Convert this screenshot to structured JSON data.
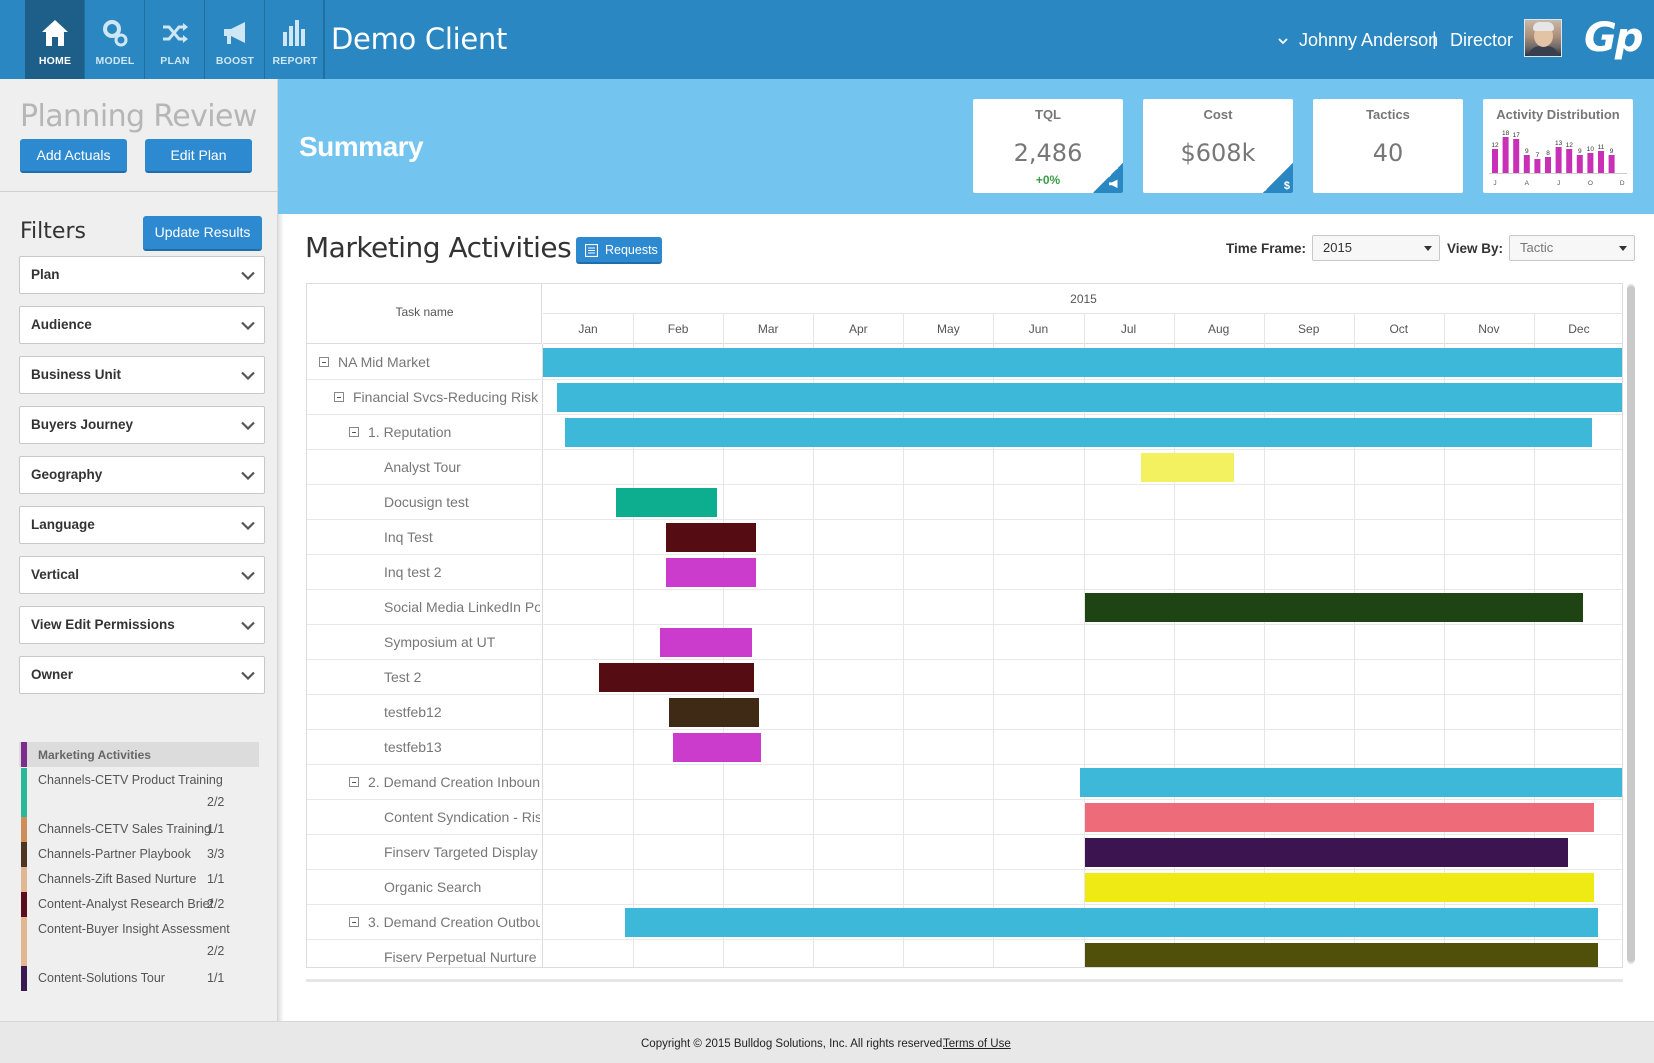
{
  "nav": [
    {
      "label": "HOME",
      "icon": "home-icon",
      "active": true
    },
    {
      "label": "MODEL",
      "icon": "gears-icon",
      "active": false
    },
    {
      "label": "PLAN",
      "icon": "shuffle-icon",
      "active": false
    },
    {
      "label": "BOOST",
      "icon": "megaphone-icon",
      "active": false
    },
    {
      "label": "REPORT",
      "icon": "bar-chart-icon",
      "active": false
    }
  ],
  "header": {
    "client": "Demo Client",
    "user_name": "Johnny Anderson",
    "separator": "|",
    "user_role": "Director",
    "logo": "Gp"
  },
  "left": {
    "title": "Planning Review",
    "add_actuals": "Add Actuals",
    "edit_plan": "Edit Plan",
    "filters_title": "Filters",
    "update_results": "Update Results",
    "filters": [
      "Plan",
      "Audience",
      "Business Unit",
      "Buyers Journey",
      "Geography",
      "Language",
      "Vertical",
      "View Edit Permissions",
      "Owner"
    ],
    "legend_header": "Marketing Activities",
    "legend_header_color": "#7a2d8d",
    "legend": [
      {
        "name": "Channels-CETV Product Training",
        "count": "2/2",
        "color": "#2bb89a",
        "wrap": true
      },
      {
        "name": "Channels-CETV Sales Training",
        "count": "1/1",
        "color": "#cf8e57",
        "wrap": false
      },
      {
        "name": "Channels-Partner Playbook",
        "count": "3/3",
        "color": "#4c3522",
        "wrap": false
      },
      {
        "name": "Channels-Zift Based Nurture",
        "count": "1/1",
        "color": "#e2b894",
        "wrap": false
      },
      {
        "name": "Content-Analyst Research Brief",
        "count": "2/2",
        "color": "#5b0d1e",
        "wrap": false
      },
      {
        "name": "Content-Buyer Insight Assessment",
        "count": "2/2",
        "color": "#e2b894",
        "wrap": true
      },
      {
        "name": "Content-Solutions Tour",
        "count": "1/1",
        "color": "#3a1a4e",
        "wrap": false
      }
    ]
  },
  "summary": {
    "title": "Summary",
    "kpis": [
      {
        "title": "TQL",
        "value": "2,486",
        "delta": "+0%",
        "corner_icon": "megaphone-icon"
      },
      {
        "title": "Cost",
        "value": "$608k",
        "delta": "",
        "corner_icon": "dollar-icon",
        "corner_glyph": "$"
      },
      {
        "title": "Tactics",
        "value": "40",
        "delta": "",
        "corner_icon": ""
      }
    ],
    "distribution": {
      "title": "Activity Distribution",
      "color": "#c830b8",
      "labels": [
        "12",
        "18",
        "17",
        "9",
        "7",
        "8",
        "13",
        "12",
        "9",
        "10",
        "11",
        "9"
      ],
      "values": [
        12,
        18,
        17,
        9,
        7,
        8,
        13,
        12,
        9,
        10,
        11,
        9
      ],
      "x_labels": [
        "J",
        "A",
        "J",
        "O",
        "D"
      ]
    }
  },
  "activities": {
    "title": "Marketing Activities",
    "requests_label": "Requests",
    "timeframe_label": "Time Frame:",
    "timeframe_value": "2015",
    "viewby_label": "View By:",
    "viewby_value": "Tactic"
  },
  "gantt": {
    "task_header": "Task name",
    "year": "2015",
    "months": [
      "Jan",
      "Feb",
      "Mar",
      "Apr",
      "May",
      "Jun",
      "Jul",
      "Aug",
      "Sep",
      "Oct",
      "Nov",
      "Dec"
    ],
    "rows": [
      {
        "name": "NA Mid Market",
        "level": 0,
        "toggle": true,
        "start": 0.0,
        "end": 12.0,
        "color": "#3db8d8"
      },
      {
        "name": "Financial Svcs-Reducing Risk v",
        "level": 1,
        "toggle": true,
        "start": 0.15,
        "end": 12.0,
        "color": "#3db8d8"
      },
      {
        "name": "1. Reputation",
        "level": 2,
        "toggle": true,
        "start": 0.24,
        "end": 11.65,
        "color": "#3db8d8"
      },
      {
        "name": "Analyst Tour",
        "level": 3,
        "toggle": false,
        "start": 6.64,
        "end": 7.67,
        "color": "#f3f15f"
      },
      {
        "name": "Docusign test",
        "level": 3,
        "toggle": false,
        "start": 0.81,
        "end": 1.93,
        "color": "#0dae90"
      },
      {
        "name": "Inq Test",
        "level": 3,
        "toggle": false,
        "start": 1.37,
        "end": 2.37,
        "color": "#550c13"
      },
      {
        "name": "Inq test 2",
        "level": 3,
        "toggle": false,
        "start": 1.37,
        "end": 2.37,
        "color": "#cc3ccc"
      },
      {
        "name": "Social Media LinkedIn Po",
        "level": 3,
        "toggle": false,
        "start": 6.02,
        "end": 11.54,
        "color": "#1e4414"
      },
      {
        "name": "Symposium at UT",
        "level": 3,
        "toggle": false,
        "start": 1.3,
        "end": 2.32,
        "color": "#cc3ccc"
      },
      {
        "name": "Test 2",
        "level": 3,
        "toggle": false,
        "start": 0.62,
        "end": 2.34,
        "color": "#550c13"
      },
      {
        "name": "testfeb12",
        "level": 3,
        "toggle": false,
        "start": 1.4,
        "end": 2.4,
        "color": "#3e2a15"
      },
      {
        "name": "testfeb13",
        "level": 3,
        "toggle": false,
        "start": 1.44,
        "end": 2.42,
        "color": "#cc3ccc"
      },
      {
        "name": "2. Demand Creation Inboun",
        "level": 2,
        "toggle": true,
        "start": 5.96,
        "end": 12.0,
        "color": "#3db8d8"
      },
      {
        "name": "Content Syndication - Ris",
        "level": 3,
        "toggle": false,
        "start": 6.02,
        "end": 11.67,
        "color": "#ee6b7a"
      },
      {
        "name": "Finserv Targeted Display",
        "level": 3,
        "toggle": false,
        "start": 6.02,
        "end": 11.38,
        "color": "#3c1550"
      },
      {
        "name": "Organic Search",
        "level": 3,
        "toggle": false,
        "start": 6.02,
        "end": 11.67,
        "color": "#f0ea14"
      },
      {
        "name": "3. Demand Creation Outbou",
        "level": 2,
        "toggle": true,
        "start": 0.91,
        "end": 11.71,
        "color": "#3db8d8"
      },
      {
        "name": "Fiserv Perpetual Nurture",
        "level": 3,
        "toggle": false,
        "start": 6.02,
        "end": 11.71,
        "color": "#51500b"
      }
    ]
  },
  "footer": {
    "copyright": "Copyright © 2015 Bulldog Solutions, Inc. All rights reserved.",
    "terms": "Terms of Use"
  }
}
